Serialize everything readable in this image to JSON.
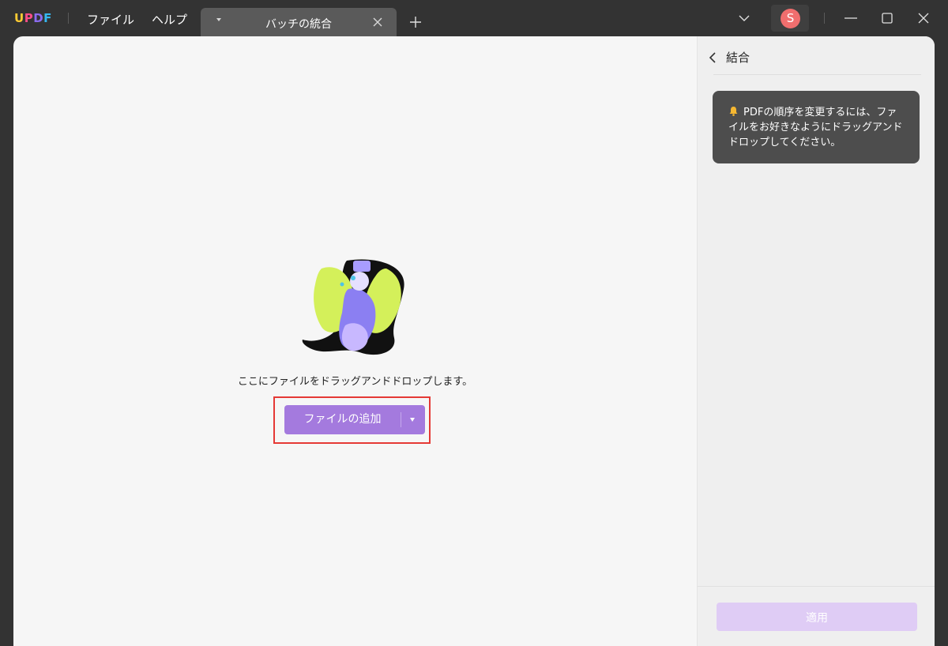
{
  "app": {
    "logo_letters": [
      "U",
      "P",
      "D",
      "F"
    ],
    "logo_colors": [
      "#ffcc33",
      "#ff4d8a",
      "#8c6cf0",
      "#35b8f0"
    ]
  },
  "menu": {
    "file": "ファイル",
    "help": "ヘルプ"
  },
  "tab": {
    "title": "バッチの統合"
  },
  "user": {
    "avatar_letter": "S",
    "avatar_color": "#f06e6e"
  },
  "main": {
    "drop_text": "ここにファイルをドラッグアンドドロップします。",
    "add_button_label": "ファイルの追加"
  },
  "sidebar": {
    "title": "結合",
    "tip": "PDFの順序を変更するには、ファイルをお好きなようにドラッグアンドドロップしてください。",
    "apply_label": "適用"
  },
  "colors": {
    "accent": "#a47ade",
    "apply_disabled": "#dfccf5",
    "highlight": "#e53935"
  }
}
